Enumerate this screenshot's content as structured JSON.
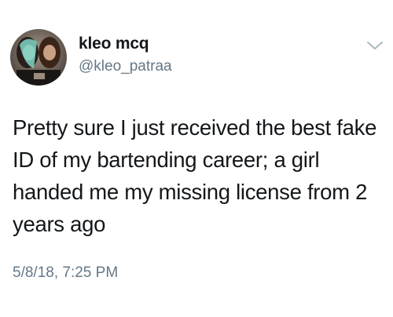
{
  "tweet": {
    "author": {
      "display_name": "kleo mcq",
      "handle": "@kleo_patraa",
      "avatar_icon": "profile-photo"
    },
    "menu_icon": "chevron-down-icon",
    "text_lines": [
      "Pretty sure I just received the best fake",
      "ID of my bartending career; a girl",
      "handed me my missing license from 2",
      "years ago"
    ],
    "timestamp": "5/8/18, 7:25 PM"
  },
  "colors": {
    "text": "#14171a",
    "secondary": "#657786",
    "background": "#ffffff"
  }
}
